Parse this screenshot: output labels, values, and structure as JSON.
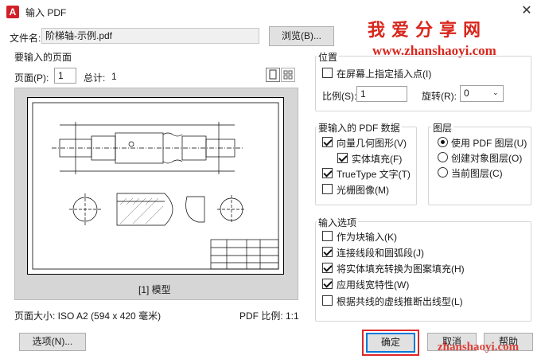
{
  "window": {
    "title": "输入 PDF",
    "app_icon": "A",
    "close_glyph": "✕"
  },
  "watermark": {
    "text": "我爱分享网",
    "url": "www.zhanshaoyi.com",
    "url_bottom": "zhanshaoyi.com",
    "color": "#d9261c"
  },
  "file": {
    "label": "文件名:",
    "value": "阶梯轴-示例.pdf",
    "browse_label": "浏览(B)..."
  },
  "pages": {
    "group_title": "要输入的页面",
    "page_label": "页面(P):",
    "page_value": "1",
    "total_label": "总计:",
    "total_value": "1",
    "preview_caption": "[1] 模型",
    "page_size": "页面大小: ISO A2 (594 x 420 毫米)",
    "pdf_scale": "PDF 比例: 1:1"
  },
  "position": {
    "group_title": "位置",
    "specify_on_screen": "在屏幕上指定插入点(I)",
    "scale_label": "比例(S):",
    "scale_value": "1",
    "rotation_label": "旋转(R):",
    "rotation_value": "0"
  },
  "pdf_data": {
    "group_title": "要输入的 PDF 数据",
    "vector_geometry": "向量几何图形(V)",
    "solid_fill": "实体填充(F)",
    "truetype_text": "TrueType 文字(T)",
    "raster_images": "光栅图像(M)"
  },
  "layers": {
    "group_title": "图层",
    "use_pdf_layers": "使用 PDF 图层(U)",
    "create_object_layers": "创建对象图层(O)",
    "current_layer": "当前图层(C)"
  },
  "import_options": {
    "group_title": "输入选项",
    "as_block": "作为块输入(K)",
    "join_segments": "连接线段和圆弧段(J)",
    "convert_solid_fills": "将实体填充转换为图案填充(H)",
    "apply_lineweight": "应用线宽特性(W)",
    "infer_linetypes": "根据共线的虚线推断出线型(L)"
  },
  "footer": {
    "options_label": "选项(N)...",
    "ok_label": "确定",
    "cancel_label": "取消",
    "help_label": "帮助"
  }
}
